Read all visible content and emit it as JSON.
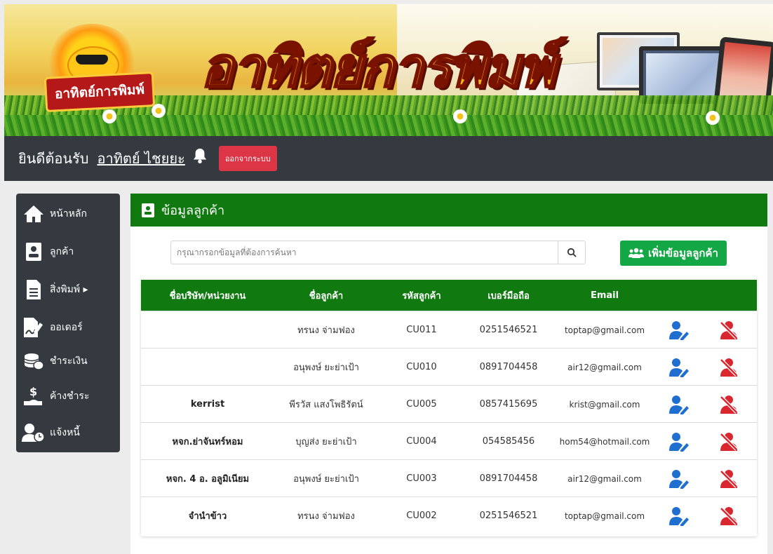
{
  "banner": {
    "logo_text": "อาทิตย์การพิมพ์",
    "title": "อาทิตย์การพิมพ์"
  },
  "topbar": {
    "welcome": "ยินดีต้อนรับ",
    "username": "อาทิตย์ ไชยยะ",
    "logout": "ออกจากระบบ"
  },
  "sidebar": {
    "items": [
      {
        "label": "หน้าหลัก",
        "icon": "home-icon"
      },
      {
        "label": "ลูกค้า",
        "icon": "contact-card-icon"
      },
      {
        "label": "สิ่งพิมพ์ ▸",
        "icon": "document-icon"
      },
      {
        "label": "ออเดอร์",
        "icon": "file-signature-icon"
      },
      {
        "label": "ชำระเงิน",
        "icon": "coins-icon"
      },
      {
        "label": "ค้างชำระ",
        "icon": "hand-dollar-icon"
      },
      {
        "label": "แจ้งหนี้",
        "icon": "user-clock-icon"
      }
    ]
  },
  "main": {
    "title": "ข้อมูลลูกค้า",
    "search_placeholder": "กรุณากรอกข้อมูลที่ต้องการค้นหา",
    "add_button": "เพิ่มข้อมูลลูกค้า",
    "columns": [
      "ชื่อบริษัท/หน่วยงาน",
      "ชื่อลูกค้า",
      "รหัสลูกค้า",
      "เบอร์มือถือ",
      "Email"
    ],
    "rows": [
      {
        "company": "",
        "name": "ทรนง จ่ามฟอง",
        "code": "CU011",
        "phone": "0251546521",
        "email": "toptap@gmail.com"
      },
      {
        "company": "",
        "name": "อนุพงษ์ ยะย่าเป้า",
        "code": "CU010",
        "phone": "0891704458",
        "email": "air12@gmail.com"
      },
      {
        "company": "kerrist",
        "name": "พีรวัส แสงโพธิรัตน์",
        "code": "CU005",
        "phone": "0857415695",
        "email": "krist@gmail.com"
      },
      {
        "company": "หจก.ย่าจันทร์หอม",
        "name": "บุญส่ง ยะย่าเป้า",
        "code": "CU004",
        "phone": "054585456",
        "email": "hom54@hotmail.com"
      },
      {
        "company": "หจก. 4 อ. อลูมิเนียม",
        "name": "อนุพงษ์ ยะย่าเป้า",
        "code": "CU003",
        "phone": "0891704458",
        "email": "air12@gmail.com"
      },
      {
        "company": "จำนำข้าว",
        "name": "ทรนง จ่ามฟอง",
        "code": "CU002",
        "phone": "0251546521",
        "email": "toptap@gmail.com"
      }
    ]
  },
  "colors": {
    "green_header": "#107a10",
    "add_button": "#13a745",
    "dark_bar": "#343a40",
    "logout": "#dc3545",
    "edit_icon": "#1f6fd1",
    "delete_icon": "#d9262f"
  }
}
